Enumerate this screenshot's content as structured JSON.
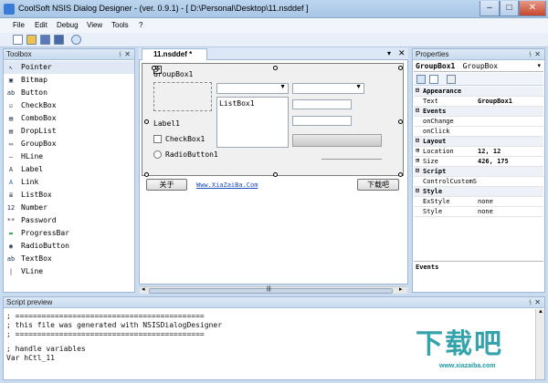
{
  "window": {
    "title": "CoolSoft NSIS Dialog Designer - (ver. 0.9.1) - [ D:\\Personal\\Desktop\\11.nsddef ]",
    "min_glyph": "–",
    "max_glyph": "□",
    "close_glyph": "✕"
  },
  "menu": [
    "File",
    "Edit",
    "Debug",
    "View",
    "Tools",
    "?"
  ],
  "toolbox": {
    "title": "Toolbox",
    "pin_glyph": "ᚾ",
    "close_glyph": "✕",
    "items": [
      {
        "label": "Pointer",
        "icon": "pointer-icon",
        "glyph": "↖"
      },
      {
        "label": "Bitmap",
        "icon": "bitmap-icon",
        "glyph": "▣"
      },
      {
        "label": "Button",
        "icon": "button-icon",
        "glyph": "ab"
      },
      {
        "label": "CheckBox",
        "icon": "checkbox-icon",
        "glyph": "☑"
      },
      {
        "label": "ComboBox",
        "icon": "combobox-icon",
        "glyph": "▤"
      },
      {
        "label": "DropList",
        "icon": "droplist-icon",
        "glyph": "▤"
      },
      {
        "label": "GroupBox",
        "icon": "groupbox-icon",
        "glyph": "▭"
      },
      {
        "label": "HLine",
        "icon": "hline-icon",
        "glyph": "—"
      },
      {
        "label": "Label",
        "icon": "label-icon",
        "glyph": "A"
      },
      {
        "label": "Link",
        "icon": "link-icon",
        "glyph": "A"
      },
      {
        "label": "ListBox",
        "icon": "listbox-icon",
        "glyph": "≣"
      },
      {
        "label": "Number",
        "icon": "number-icon",
        "glyph": "12"
      },
      {
        "label": "Password",
        "icon": "password-icon",
        "glyph": "**"
      },
      {
        "label": "ProgressBar",
        "icon": "progressbar-icon",
        "glyph": "▬"
      },
      {
        "label": "RadioButton",
        "icon": "radiobutton-icon",
        "glyph": "◉"
      },
      {
        "label": "TextBox",
        "icon": "textbox-icon",
        "glyph": "ab"
      },
      {
        "label": "VLine",
        "icon": "vline-icon",
        "glyph": "|"
      }
    ]
  },
  "designer": {
    "tab_label": "11.nsddef *",
    "tab_dropdown_glyph": "▾",
    "tab_close_glyph": "✕",
    "dialog": {
      "groupbox_label": "GroupBox1",
      "label1": "Label1",
      "checkbox_label": "CheckBox1",
      "radio_label": "RadioButton1",
      "listbox_item": "ListBox1",
      "button_left": "关于",
      "link_text": "Www.XiaZaiBa.Com",
      "button_right": "下载吧"
    },
    "hscroll_glyph": "|||"
  },
  "properties": {
    "title": "Properties",
    "selected_object": "GroupBox1",
    "selected_type": "GroupBox",
    "rows": [
      {
        "type": "category",
        "name": "Appearance"
      },
      {
        "type": "prop",
        "name": "Text",
        "value": "GroupBox1",
        "bold": true
      },
      {
        "type": "category",
        "name": "Events"
      },
      {
        "type": "prop",
        "name": "onChange",
        "value": ""
      },
      {
        "type": "prop",
        "name": "onClick",
        "value": ""
      },
      {
        "type": "category",
        "name": "Layout"
      },
      {
        "type": "prop",
        "name": "Location",
        "value": "12, 12",
        "bold": true,
        "expandable": true
      },
      {
        "type": "prop",
        "name": "Size",
        "value": "426, 175",
        "bold": true,
        "expandable": true
      },
      {
        "type": "category",
        "name": "Script"
      },
      {
        "type": "prop",
        "name": "ControlCustomS",
        "value": ""
      },
      {
        "type": "category",
        "name": "Style"
      },
      {
        "type": "prop",
        "name": "ExStyle",
        "value": "none"
      },
      {
        "type": "prop",
        "name": "Style",
        "value": "none"
      }
    ],
    "events_label": "Events"
  },
  "script_preview": {
    "title": "Script preview",
    "lines": [
      "; ===========================================",
      "; this file was generated with NSISDialogDesigner",
      "; ===========================================",
      "",
      "; handle variables",
      "Var hCtl_11"
    ]
  },
  "watermark": {
    "logo": "下载吧",
    "url": "www.xiazaiba.com"
  }
}
